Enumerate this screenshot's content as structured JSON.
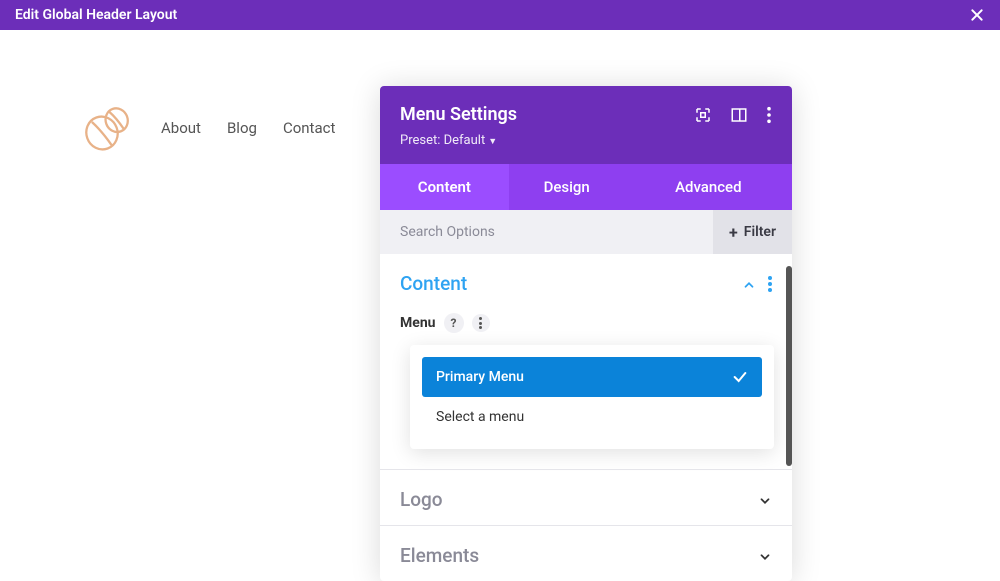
{
  "topbar": {
    "title": "Edit Global Header Layout"
  },
  "nav": {
    "items": [
      "About",
      "Blog",
      "Contact"
    ]
  },
  "panel": {
    "title": "Menu Settings",
    "preset_label": "Preset: Default",
    "tabs": [
      "Content",
      "Design",
      "Advanced"
    ],
    "active_tab": 0,
    "search_placeholder": "Search Options",
    "filter_label": "Filter",
    "sections": {
      "content": {
        "title": "Content"
      },
      "logo": {
        "title": "Logo"
      },
      "elements": {
        "title": "Elements"
      }
    },
    "field": {
      "label": "Menu",
      "options": [
        "Primary Menu",
        "Select a menu"
      ],
      "selected": 0
    }
  }
}
